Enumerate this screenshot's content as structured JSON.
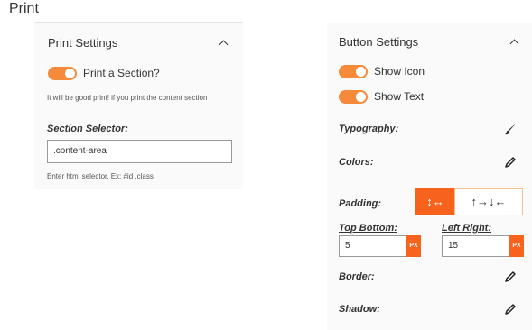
{
  "page": {
    "title": "Print"
  },
  "print_settings": {
    "header": "Print Settings",
    "toggle_label": "Print a Section?",
    "toggle_on": true,
    "help_text": "It will be good print! if you print the content section",
    "selector_label": "Section Selector:",
    "selector_value": ".content-area",
    "selector_help": "Enter html selector. Ex: #id .class"
  },
  "button_settings": {
    "header": "Button Settings",
    "show_icon_label": "Show Icon",
    "show_icon_on": true,
    "show_text_label": "Show Text",
    "show_text_on": true,
    "typography_label": "Typography:",
    "colors_label": "Colors:",
    "padding_label": "Padding:",
    "padding_modes": [
      {
        "label": "↕↔",
        "active": true
      },
      {
        "label": "↑→↓←",
        "active": false
      }
    ],
    "top_bottom_label": "Top Bottom:",
    "top_bottom_value": "5",
    "left_right_label": "Left Right:",
    "left_right_value": "15",
    "unit": "PX",
    "border_label": "Border:",
    "shadow_label": "Shadow:"
  },
  "colors": {
    "accent": "#f7621d",
    "toggle": "#f58b3a"
  }
}
